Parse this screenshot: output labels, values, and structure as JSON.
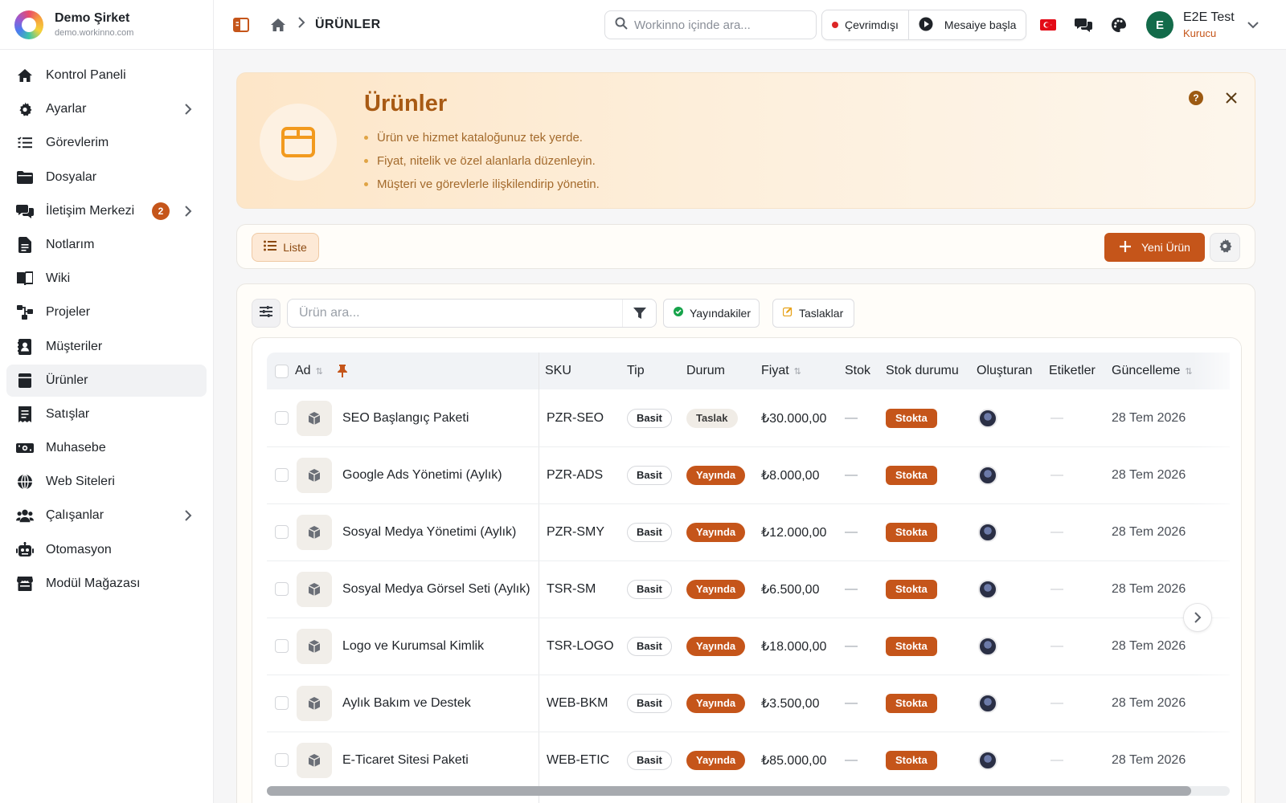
{
  "brand": {
    "name": "Demo Şirket",
    "domain": "demo.workinno.com"
  },
  "sidebar": {
    "items": [
      {
        "label": "Kontrol Paneli",
        "icon": "home-icon"
      },
      {
        "label": "Ayarlar",
        "icon": "gear-icon",
        "has_submenu": true
      },
      {
        "label": "Görevlerim",
        "icon": "task-list-icon"
      },
      {
        "label": "Dosyalar",
        "icon": "folder-icon"
      },
      {
        "label": "İletişim Merkezi",
        "icon": "chat-icon",
        "badge": "2",
        "has_submenu": true
      },
      {
        "label": "Notlarım",
        "icon": "note-icon"
      },
      {
        "label": "Wiki",
        "icon": "book-icon"
      },
      {
        "label": "Projeler",
        "icon": "project-icon"
      },
      {
        "label": "Müşteriler",
        "icon": "contacts-icon"
      },
      {
        "label": "Ürünler",
        "icon": "product-icon",
        "active": true
      },
      {
        "label": "Satışlar",
        "icon": "receipt-icon"
      },
      {
        "label": "Muhasebe",
        "icon": "money-icon"
      },
      {
        "label": "Web Siteleri",
        "icon": "globe-icon"
      },
      {
        "label": "Çalışanlar",
        "icon": "users-icon",
        "has_submenu": true
      },
      {
        "label": "Otomasyon",
        "icon": "robot-icon"
      },
      {
        "label": "Modül Mağazası",
        "icon": "store-icon"
      }
    ]
  },
  "header": {
    "breadcrumb": "ÜRÜNLER",
    "search_placeholder": "Workinno içinde ara...",
    "status_label": "Çevrimdışı",
    "shift_label": "Mesaiye başla",
    "user_initial": "E",
    "user_name": "E2E Test",
    "user_role": "Kurucu"
  },
  "banner": {
    "title": "Ürünler",
    "bullets": [
      "Ürün ve hizmet kataloğunuz tek yerde.",
      "Fiyat, nitelik ve özel alanlarla düzenleyin.",
      "Müşteri ve görevlerle ilişkilendirip yönetin."
    ]
  },
  "toolbar": {
    "view_label": "Liste",
    "new_label": "Yeni Ürün"
  },
  "filters": {
    "search_placeholder": "Ürün ara...",
    "published_label": "Yayındakiler",
    "drafts_label": "Taslaklar"
  },
  "table": {
    "columns": [
      "Ad",
      "SKU",
      "Tip",
      "Durum",
      "Fiyat",
      "Stok",
      "Stok durumu",
      "Oluşturan",
      "Etiketler",
      "Güncelleme"
    ],
    "rows": [
      {
        "name": "SEO Başlangıç Paketi",
        "sku": "PZR-SEO",
        "type": "Basit",
        "status": "Taslak",
        "status_kind": "draft",
        "price": "₺30.000,00",
        "stock": "—",
        "stock_status": "Stokta",
        "tags": "—",
        "updated": "28 Tem 2026"
      },
      {
        "name": "Google Ads Yönetimi (Aylık)",
        "sku": "PZR-ADS",
        "type": "Basit",
        "status": "Yayında",
        "status_kind": "live",
        "price": "₺8.000,00",
        "stock": "—",
        "stock_status": "Stokta",
        "tags": "—",
        "updated": "28 Tem 2026"
      },
      {
        "name": "Sosyal Medya Yönetimi (Aylık)",
        "sku": "PZR-SMY",
        "type": "Basit",
        "status": "Yayında",
        "status_kind": "live",
        "price": "₺12.000,00",
        "stock": "—",
        "stock_status": "Stokta",
        "tags": "—",
        "updated": "28 Tem 2026"
      },
      {
        "name": "Sosyal Medya Görsel Seti (Aylık)",
        "sku": "TSR-SM",
        "type": "Basit",
        "status": "Yayında",
        "status_kind": "live",
        "price": "₺6.500,00",
        "stock": "—",
        "stock_status": "Stokta",
        "tags": "—",
        "updated": "28 Tem 2026"
      },
      {
        "name": "Logo ve Kurumsal Kimlik",
        "sku": "TSR-LOGO",
        "type": "Basit",
        "status": "Yayında",
        "status_kind": "live",
        "price": "₺18.000,00",
        "stock": "—",
        "stock_status": "Stokta",
        "tags": "—",
        "updated": "28 Tem 2026"
      },
      {
        "name": "Aylık Bakım ve Destek",
        "sku": "WEB-BKM",
        "type": "Basit",
        "status": "Yayında",
        "status_kind": "live",
        "price": "₺3.500,00",
        "stock": "—",
        "stock_status": "Stokta",
        "tags": "—",
        "updated": "28 Tem 2026"
      },
      {
        "name": "E-Ticaret Sitesi Paketi",
        "sku": "WEB-ETIC",
        "type": "Basit",
        "status": "Yayında",
        "status_kind": "live",
        "price": "₺85.000,00",
        "stock": "—",
        "stock_status": "Stokta",
        "tags": "—",
        "updated": "28 Tem 2026"
      }
    ]
  },
  "colors": {
    "accent": "#c5551a",
    "banner_title": "#a85a14",
    "active_nav": "#f1f2f4"
  }
}
